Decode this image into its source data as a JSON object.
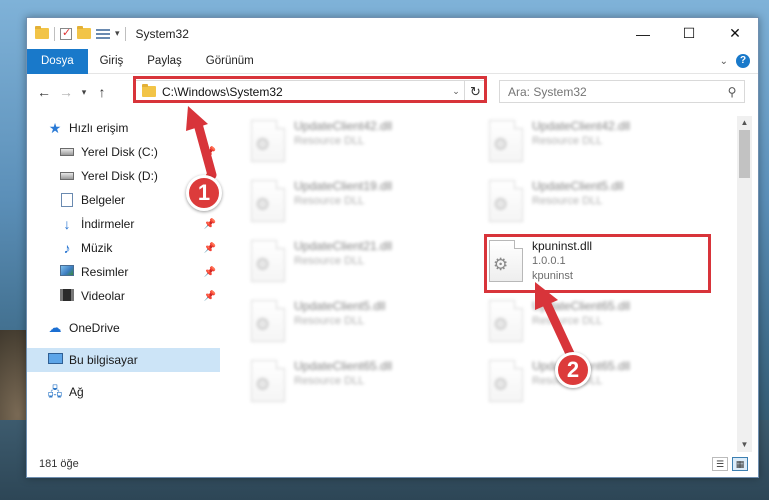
{
  "window": {
    "title": "System32"
  },
  "ribbon": {
    "tabs": [
      "Dosya",
      "Giriş",
      "Paylaş",
      "Görünüm"
    ]
  },
  "address": {
    "path": "C:\\Windows\\System32"
  },
  "search": {
    "placeholder": "Ara: System32"
  },
  "sidebar": {
    "items": [
      {
        "label": "Hızlı erişim",
        "icon": "star-icon",
        "pinned": false
      },
      {
        "label": "Yerel Disk (C:)",
        "icon": "disk-icon",
        "pinned": true
      },
      {
        "label": "Yerel Disk (D:)",
        "icon": "disk-icon",
        "pinned": true
      },
      {
        "label": "Belgeler",
        "icon": "document-icon",
        "pinned": true
      },
      {
        "label": "İndirmeler",
        "icon": "download-icon",
        "pinned": true
      },
      {
        "label": "Müzik",
        "icon": "music-icon",
        "pinned": true
      },
      {
        "label": "Resimler",
        "icon": "pictures-icon",
        "pinned": true
      },
      {
        "label": "Videolar",
        "icon": "videos-icon",
        "pinned": true
      },
      {
        "label": "OneDrive",
        "icon": "cloud-icon",
        "pinned": false
      },
      {
        "label": "Bu bilgisayar",
        "icon": "computer-icon",
        "pinned": false
      },
      {
        "label": "Ağ",
        "icon": "network-icon",
        "pinned": false
      }
    ]
  },
  "files": [
    {
      "name": "UpdateClient42.dll",
      "sub1": "Resource DLL",
      "sub2": ""
    },
    {
      "name": "UpdateClient42.dll",
      "sub1": "Resource DLL",
      "sub2": ""
    },
    {
      "name": "UpdateClient19.dll",
      "sub1": "Resource DLL",
      "sub2": ""
    },
    {
      "name": "UpdateClient5.dll",
      "sub1": "Resource DLL",
      "sub2": ""
    },
    {
      "name": "UpdateClient21.dll",
      "sub1": "Resource DLL",
      "sub2": ""
    },
    {
      "name": "kpuninst.dll",
      "sub1": "1.0.0.1",
      "sub2": "kpuninst"
    },
    {
      "name": "UpdateClient5.dll",
      "sub1": "Resource DLL",
      "sub2": ""
    },
    {
      "name": "UpdateClient65.dll",
      "sub1": "Resource DLL",
      "sub2": ""
    },
    {
      "name": "UpdateClient65.dll",
      "sub1": "Resource DLL",
      "sub2": ""
    },
    {
      "name": "UpdateClient65.dll",
      "sub1": "Resource DLL",
      "sub2": ""
    }
  ],
  "status": {
    "count": "181 öğe"
  },
  "annotations": {
    "badge1": "1",
    "badge2": "2"
  },
  "colors": {
    "accent": "#1979ca",
    "highlight": "#d8343a",
    "selected": "#cce4f7"
  }
}
